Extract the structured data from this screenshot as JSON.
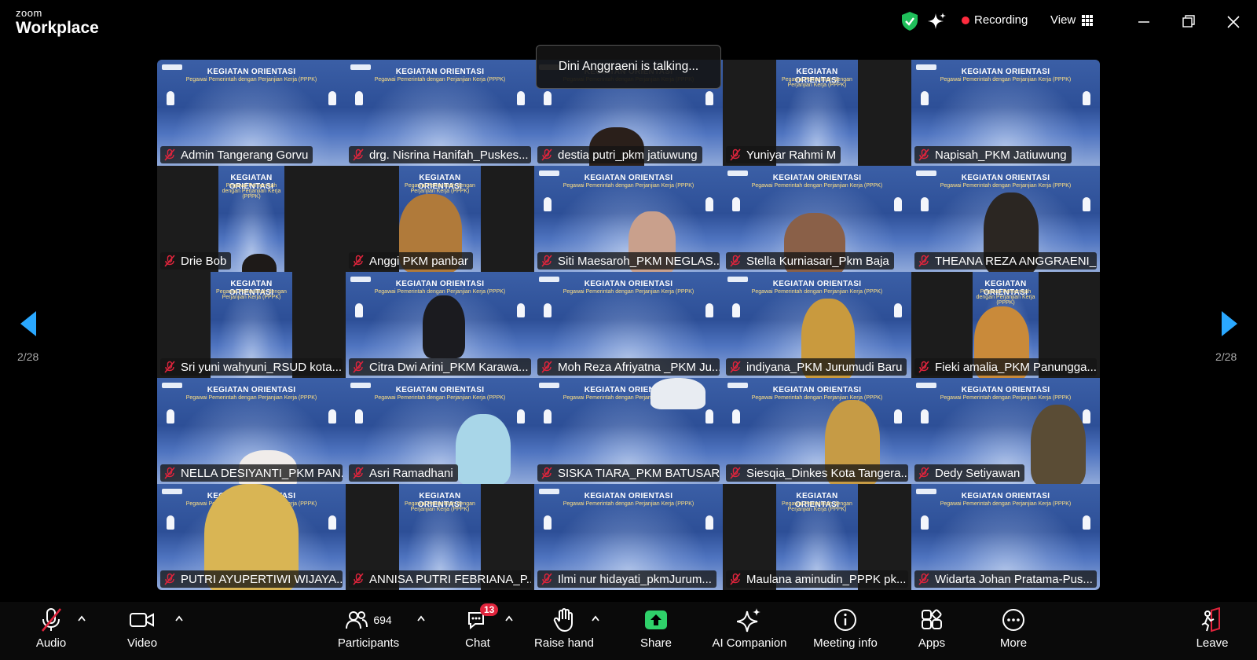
{
  "app": {
    "brand_small": "zoom",
    "brand_large": "Workplace"
  },
  "titlebar": {
    "recording": "Recording",
    "view": "View"
  },
  "talking": "Dini Anggraeni is talking...",
  "banner": {
    "line1": "KEGIATAN ORIENTASI",
    "line2": "Pegawai Pemerintah dengan Perjanjian Kerja (PPPK)"
  },
  "pagination": {
    "left": "2/28",
    "right": "2/28"
  },
  "participants": [
    "Admin Tangerang Gorvu",
    "drg. Nisrina Hanifah_Puskes...",
    "destia putri_pkm jatiuwung",
    "Yuniyar Rahmi M",
    "Napisah_PKM Jatiuwung",
    "Drie Bob",
    "Anggi PKM panbar",
    "Siti Maesaroh_PKM NEGLAS...",
    "Stella Kurniasari_Pkm Baja",
    "THEANA REZA ANGGRAENI_...",
    "Sri yuni wahyuni_RSUD kota...",
    "Citra Dwi Arini_PKM Karawa...",
    "Moh Reza Afriyatna _PKM Ju...",
    "indiyana_PKM Jurumudi Baru",
    "Fieki amalia_PKM Panungga...",
    "NELLA DESIYANTI_PKM PAN...",
    "Asri Ramadhani",
    "SISKA TIARA_PKM BATUSARI",
    "Siesqia_Dinkes Kota Tangera...",
    "Dedy Setiyawan",
    "PUTRI AYUPERTIWI WIJAYA...",
    "ANNISA PUTRI FEBRIANA_P...",
    "Ilmi nur hidayati_pkmJurum...",
    "Maulana aminudin_PPPK pk...",
    "Widarta Johan Pratama-Pus..."
  ],
  "toolbar": {
    "audio": "Audio",
    "video": "Video",
    "participants": "Participants",
    "participants_count": "694",
    "chat": "Chat",
    "chat_badge": "13",
    "raise_hand": "Raise hand",
    "share": "Share",
    "ai_companion": "AI Companion",
    "meeting_info": "Meeting info",
    "apps": "Apps",
    "more": "More",
    "leave": "Leave"
  },
  "colors": {
    "share_green": "#2fd16a",
    "recording_red": "#ff2b3e",
    "arrow_blue": "#2aa8ff",
    "shield_green": "#1fbf5a"
  }
}
